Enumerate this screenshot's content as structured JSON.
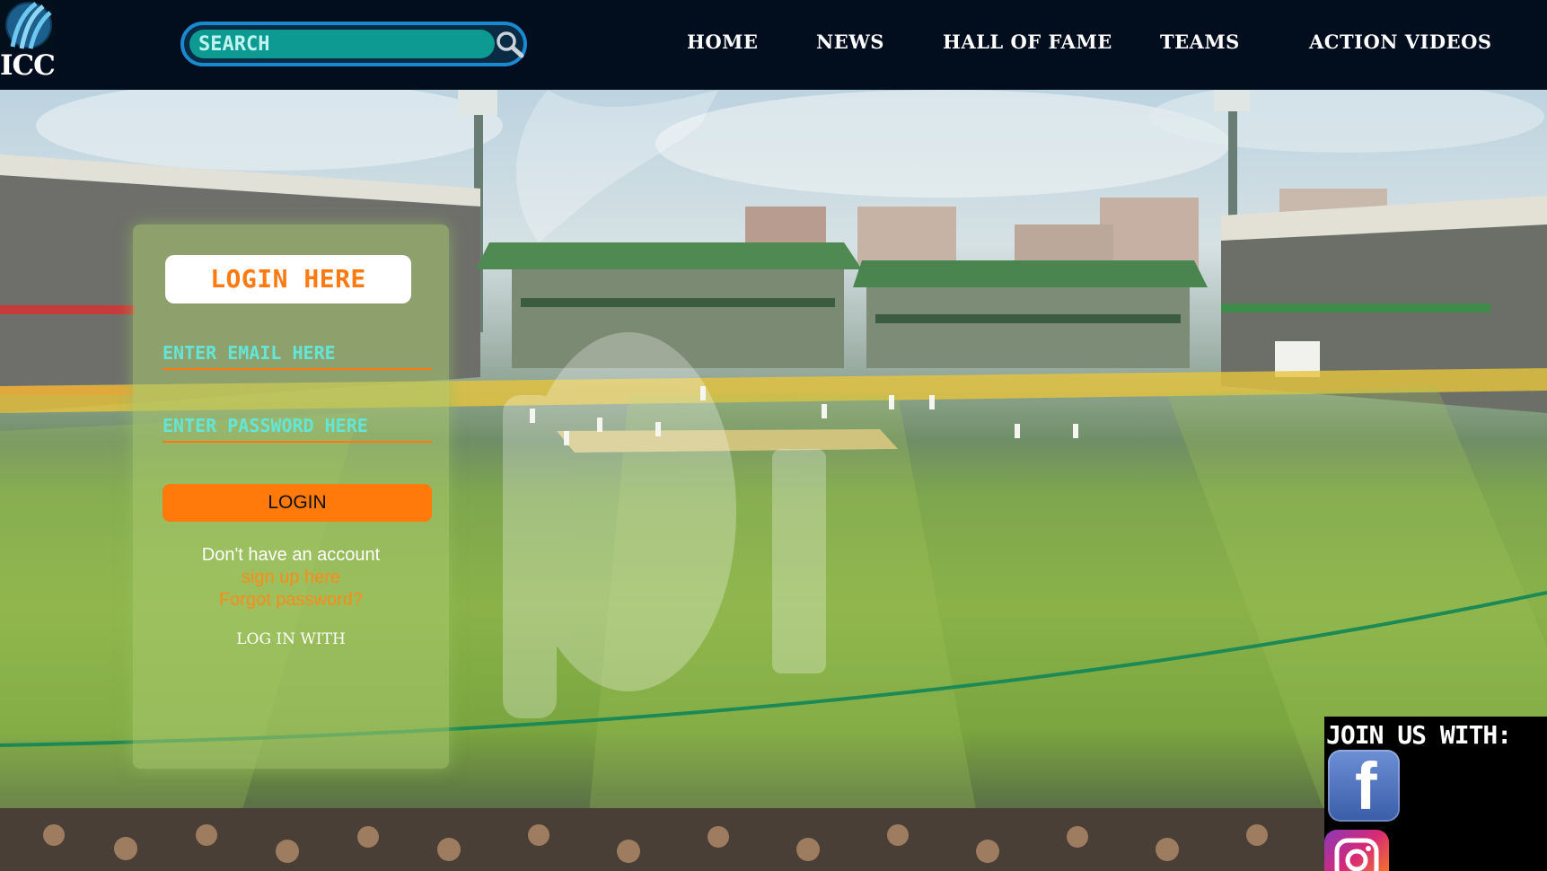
{
  "header": {
    "logo_text": "ICC",
    "search": {
      "placeholder": "SEARCH"
    },
    "nav": {
      "home": "HOME",
      "news": "NEWS",
      "hall_of_fame": "HALL OF FAME",
      "teams": "TEAMS",
      "action_videos": "ACTION VIDEOS"
    }
  },
  "login": {
    "title": "LOGIN HERE",
    "email_placeholder": "ENTER EMAIL HERE",
    "password_placeholder": "ENTER PASSWORD HERE",
    "button_label": "LOGIN",
    "no_account_text": "Don't have an account",
    "signup_link": "sign up here",
    "forgot_link": "Forgot password?",
    "login_with_text": "LOG IN WITH"
  },
  "social": {
    "heading": "JOIN US WITH:",
    "icons": [
      "facebook-icon",
      "instagram-icon"
    ]
  },
  "colors": {
    "header_bg": "#020d1e",
    "accent_orange": "#ff7a10",
    "input_teal": "#63e6d8",
    "search_fill": "#0c9a92",
    "search_border": "#1a8ad0"
  }
}
